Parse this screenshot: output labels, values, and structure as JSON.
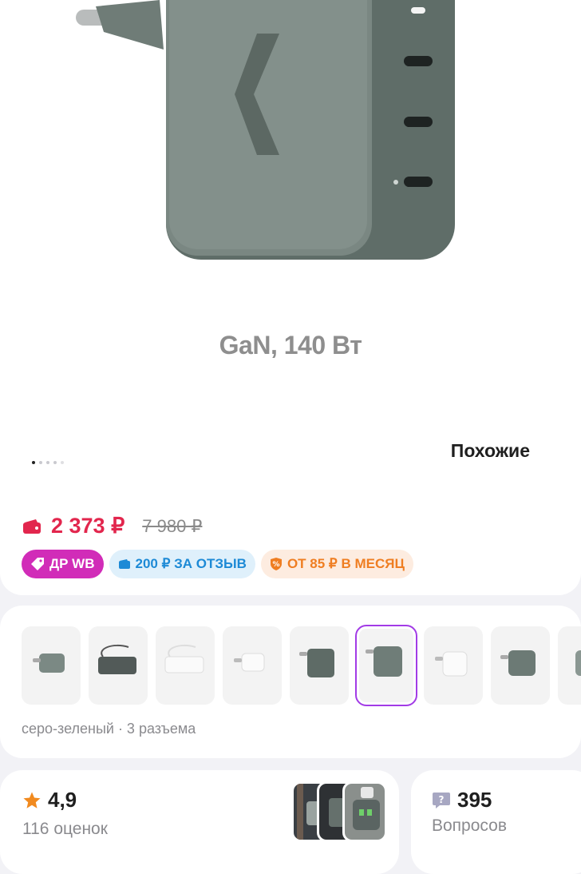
{
  "hero": {
    "caption": "GaN, 140 Вт",
    "similar_label": "Похожие",
    "dots_total": 5,
    "dots_active": 1
  },
  "price": {
    "current": "2 373 ₽",
    "old": "7 980 ₽"
  },
  "badges": [
    {
      "label": "ДР WB",
      "icon": "tag-icon"
    },
    {
      "label": "200 ₽ ЗА ОТЗЫВ",
      "icon": "wallet-icon"
    },
    {
      "label": "ОТ 85 ₽ В МЕСЯЦ",
      "icon": "shield-percent-icon"
    }
  ],
  "variants": {
    "selected_index": 5,
    "label": "серо-зеленый · 3 разъема"
  },
  "rating": {
    "value": "4,9",
    "count": "116 оценок"
  },
  "questions": {
    "count": "395",
    "label": "Вопросов"
  },
  "colors": {
    "price": "#e2264d",
    "accent_purple": "#a23be6",
    "badge_pink": "#d12cb8",
    "badge_blue": "#1d8ad6",
    "badge_orange": "#ef7e22"
  }
}
